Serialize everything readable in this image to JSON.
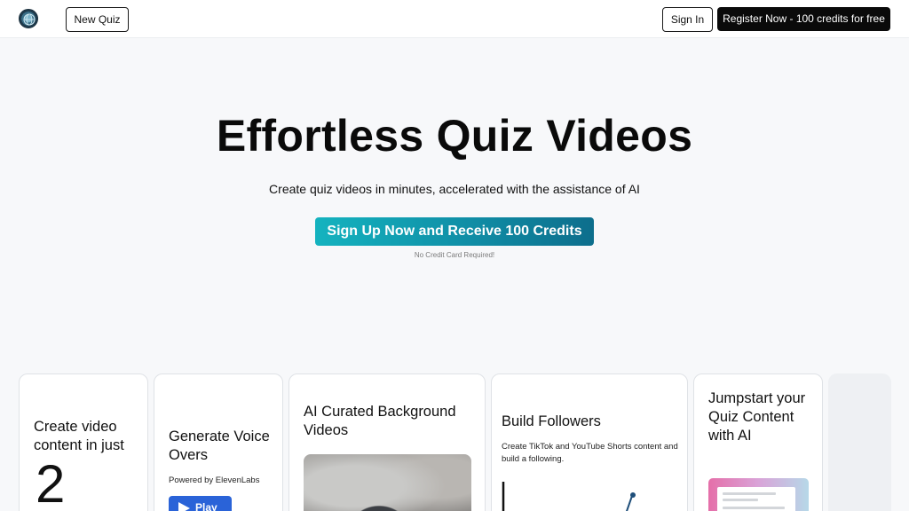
{
  "header": {
    "new_quiz_label": "New Quiz",
    "sign_in_label": "Sign In",
    "register_label": "Register Now - 100 credits for free"
  },
  "hero": {
    "title": "Effortless Quiz Videos",
    "subtitle": "Create quiz videos in minutes, accelerated with the assistance of AI",
    "cta_label": "Sign Up Now and Receive 100 Credits",
    "cta_note": "No Credit Card Required!"
  },
  "features": [
    {
      "title": "Create video content in just",
      "big_value": "2"
    },
    {
      "title": "Generate Voice Overs",
      "caption": "Powered by ElevenLabs",
      "button_label": "Play"
    },
    {
      "title": "AI Curated Background Videos"
    },
    {
      "title": "Build Followers",
      "caption": "Create TikTok and YouTube Shorts content and build a following."
    },
    {
      "title": "Jumpstart your Quiz Content with AI"
    }
  ],
  "colors": {
    "cta_gradient_start": "#14b3bf",
    "cta_gradient_end": "#0d6e8c",
    "register_bg": "#0a0a0a",
    "play_button": "#2a63d8",
    "page_bg": "#f7f8fa"
  },
  "icons": {
    "logo": "globe-logo-icon",
    "play": "play-icon"
  }
}
